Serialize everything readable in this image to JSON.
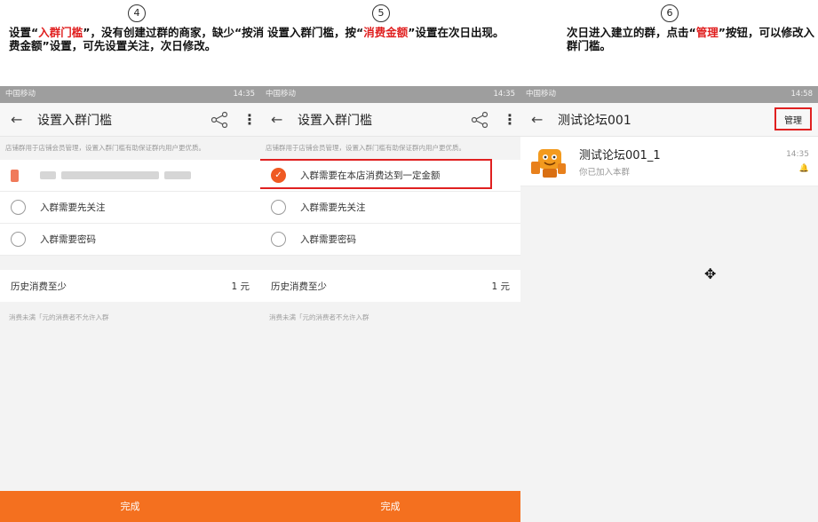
{
  "steps": [
    {
      "num": "4",
      "caption_pre": "设置“",
      "caption_hl": "入群门槛",
      "caption_post": "”，没有创建过群的商家，缺少“按消费金额”设置，可先设置关注，次日修改。"
    },
    {
      "num": "5",
      "caption_pre": "设置入群门槛，按“",
      "caption_hl": "消费金额",
      "caption_post": "”设置在次日出现。"
    },
    {
      "num": "6",
      "caption_pre": "次日进入建立的群，点击“",
      "caption_hl": "管理",
      "caption_post": "”按钮，可以修改入群门槛。"
    }
  ],
  "status_left": "中国移动",
  "status_times": [
    "14:35",
    "14:35",
    "14:58"
  ],
  "screen": {
    "title": "设置入群门槛",
    "description": "店铺群用于店铺会员管理，设置入群门槛有助保证群内用户更优质。",
    "option_spend": "入群需要在本店消费达到一定金额",
    "option_follow": "入群需要先关注",
    "option_password": "入群需要密码",
    "history_label": "历史消费至少",
    "history_value": "1 元",
    "note": "消费未满「元的消费者不允许入群",
    "done_button": "完成"
  },
  "chat": {
    "title": "测试论坛001",
    "manage_button": "管理",
    "item_name": "测试论坛001_1",
    "item_sub": "你已加入本群",
    "item_time": "14:35"
  },
  "colors": {
    "accent": "#f4701f",
    "highlight_red": "#e02020",
    "status_bar": "#9e9e9e"
  }
}
